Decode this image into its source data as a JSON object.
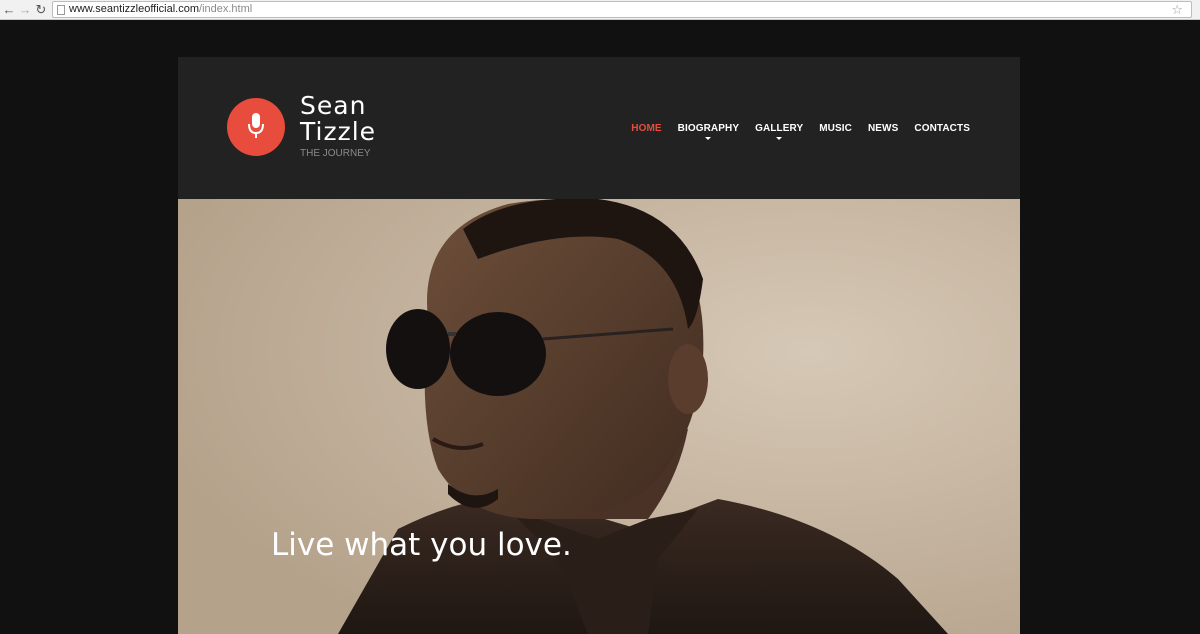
{
  "browser": {
    "url_domain": "www.seantizzleofficial.com",
    "url_path": "/index.html",
    "back_icon": "arrow-left",
    "forward_icon": "arrow-right",
    "reload_icon": "reload",
    "bookmark_icon": "star"
  },
  "site": {
    "brand": {
      "icon": "microphone-icon",
      "name": "Sean Tizzle",
      "tagline": "THE JOURNEY",
      "accent_color": "#e74c3c"
    },
    "nav": {
      "items": [
        {
          "label": "HOME",
          "active": true
        },
        {
          "label": "BIOGRAPHY",
          "dropdown": true
        },
        {
          "label": "GALLERY",
          "dropdown": true
        },
        {
          "label": "MUSIC"
        },
        {
          "label": "NEWS"
        },
        {
          "label": "CONTACTS"
        }
      ]
    },
    "hero": {
      "headline": "Live what you love."
    }
  }
}
